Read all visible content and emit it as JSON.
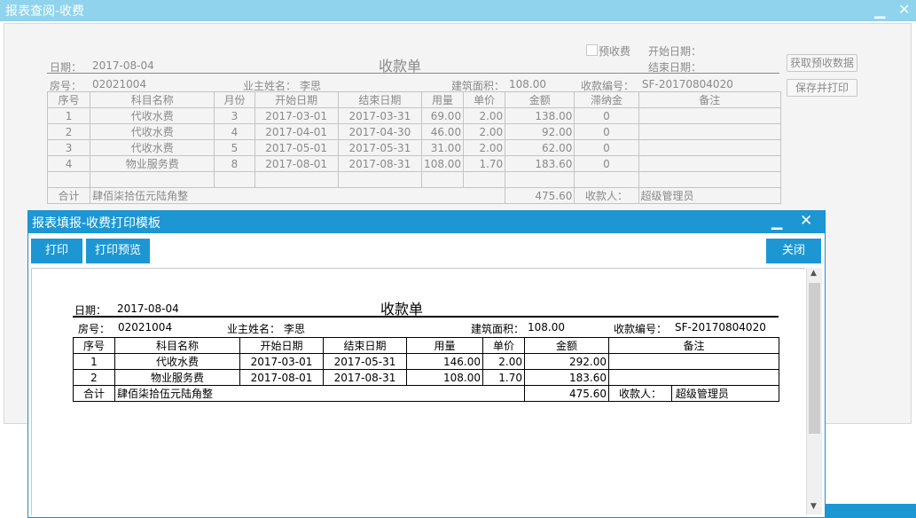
{
  "bg": {
    "title": "报表查阅-收费",
    "doc_title": "收款单",
    "date_label": "日期：",
    "date": "2017-08-04",
    "prepay_label": "预收费",
    "start_label": "开始日期：",
    "end_label": "结束日期：",
    "fetch_btn": "获取预收数据",
    "save_btn": "保存并打印",
    "room_label": "房号：",
    "room": "02021004",
    "owner_label": "业主姓名：",
    "owner": "李思",
    "area_label": "建筑面积：",
    "area": "108.00",
    "no_label": "收款编号：",
    "no": "SF-20170804020",
    "headers": [
      "序号",
      "科目名称",
      "月份",
      "开始日期",
      "结束日期",
      "用量",
      "单价",
      "金额",
      "滞纳金",
      "备注"
    ],
    "rows": [
      [
        "1",
        "代收水费",
        "3",
        "2017-03-01",
        "2017-03-31",
        "69.00",
        "2.00",
        "138.00",
        "0",
        ""
      ],
      [
        "2",
        "代收水费",
        "4",
        "2017-04-01",
        "2017-04-30",
        "46.00",
        "2.00",
        "92.00",
        "0",
        ""
      ],
      [
        "3",
        "代收水费",
        "5",
        "2017-05-01",
        "2017-05-31",
        "31.00",
        "2.00",
        "62.00",
        "0",
        ""
      ],
      [
        "4",
        "物业服务费",
        "8",
        "2017-08-01",
        "2017-08-31",
        "108.00",
        "1.70",
        "183.60",
        "0",
        ""
      ]
    ],
    "total_label": "合计",
    "total_words": "肆佰柒拾伍元陆角整",
    "total": "475.60",
    "payee_label": "收款人：",
    "payee": "超级管理员"
  },
  "modal": {
    "title": "报表填报-收费打印模板",
    "print_btn": "打印",
    "preview_btn": "打印预览",
    "close_btn": "关闭",
    "doc_title": "收款单",
    "date_label": "日期：",
    "date": "2017-08-04",
    "room_label": "房号：",
    "room": "02021004",
    "owner_label": "业主姓名：",
    "owner": "李思",
    "area_label": "建筑面积：",
    "area": "108.00",
    "no_label": "收款编号：",
    "no": "SF-20170804020",
    "headers": [
      "序号",
      "科目名称",
      "开始日期",
      "结束日期",
      "用量",
      "单价",
      "金额",
      "备注"
    ],
    "rows": [
      [
        "1",
        "代收水费",
        "2017-03-01",
        "2017-05-31",
        "146.00",
        "2.00",
        "292.00",
        ""
      ],
      [
        "2",
        "物业服务费",
        "2017-08-01",
        "2017-08-31",
        "108.00",
        "1.70",
        "183.60",
        ""
      ]
    ],
    "total_label": "合计",
    "total_words": "肆佰柒拾伍元陆角整",
    "total": "475.60",
    "payee_label": "收款人：",
    "payee": "超级管理员"
  }
}
